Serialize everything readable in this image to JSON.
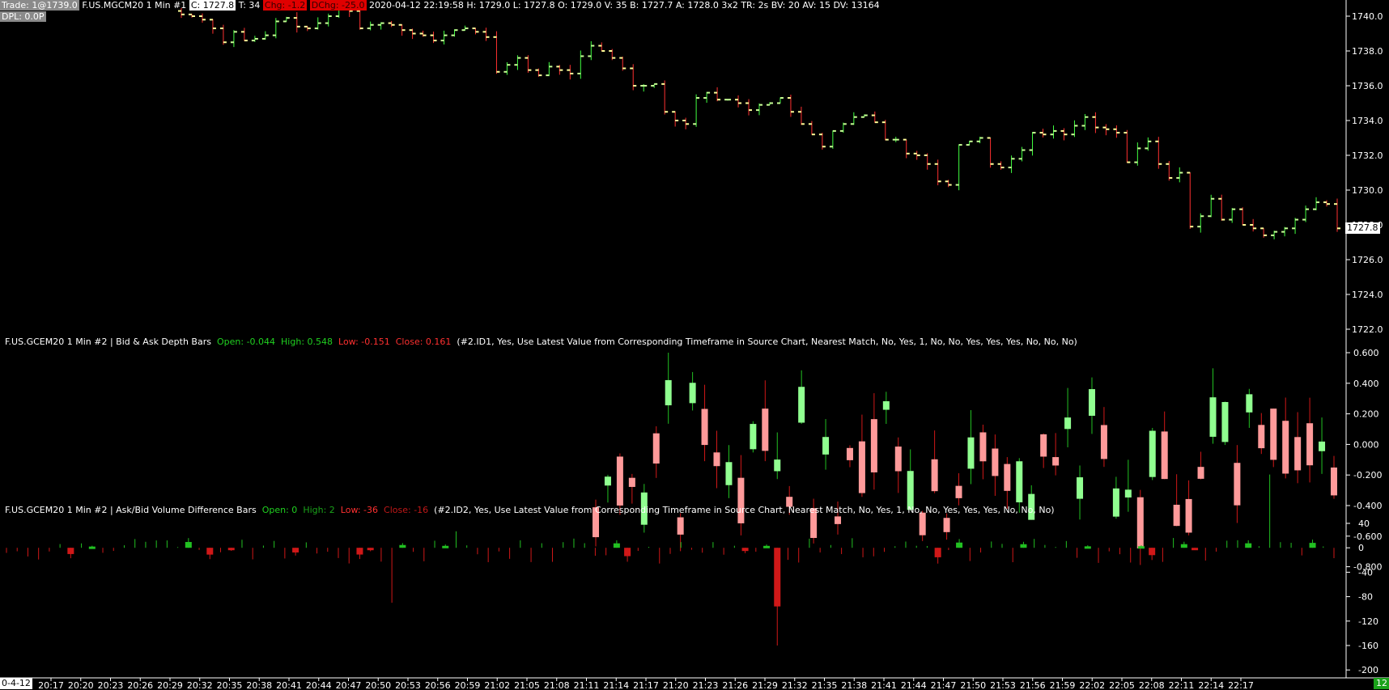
{
  "main_header": {
    "trade": "Trade: 1@1739.0",
    "symbol": "F.US.MGCM20  1 Min",
    "num": "#1",
    "close": "C: 1727.8",
    "ticks": "T: 34",
    "chg": "Chg: -1.2",
    "dchg": "DChg: -25.0",
    "info": "2020-04-12 22:19:58 H: 1729.0 L: 1727.8 O: 1729.0 V: 35 B: 1727.7 A: 1728.0 3x2 TR: 2s BV: 20 AV: 15 DV: 13164",
    "dpl": "DPL: 0.0P"
  },
  "depth_header": {
    "title": "F.US.GCEM20  1 Min   #2 | Bid & Ask Depth Bars",
    "open": "Open: -0.044",
    "high": "High: 0.548",
    "low": "Low: -0.151",
    "close": "Close: 0.161",
    "params": "(#2.ID1, Yes, Use Latest Value from Corresponding Timeframe in Source Chart, Nearest Match, No, Yes, 1, No, No, Yes, Yes, Yes, No, No, No)"
  },
  "vol_header": {
    "title": "F.US.GCEM20  1 Min   #2 | Ask/Bid Volume Difference Bars",
    "open": "Open: 0",
    "high": "High: 2",
    "low": "Low: -36",
    "close": "Close: -16",
    "params": "(#2.ID2, Yes, Use Latest Value from Corresponding Timeframe in Source Chart, Nearest Match, No, Yes, 1, No, No, Yes, Yes, Yes, No, No, No)"
  },
  "price_axis": [
    "1740.0",
    "1738.0",
    "1736.0",
    "1734.0",
    "1732.0",
    "1730.0",
    "1728.0",
    "1726.0",
    "1724.0",
    "1722.0"
  ],
  "current_price": "1727.8",
  "depth_axis": [
    "0.600",
    "0.400",
    "0.200",
    "0.000",
    "-0.200",
    "-0.400",
    "-0.600",
    "-0.800"
  ],
  "vol_axis": [
    "40",
    "0",
    "-40",
    "-80",
    "-120",
    "-160",
    "-200"
  ],
  "time_axis": {
    "date": "0-4-12",
    "times": [
      "20:17",
      "20:20",
      "20:23",
      "20:26",
      "20:29",
      "20:32",
      "20:35",
      "20:38",
      "20:41",
      "20:44",
      "20:47",
      "20:50",
      "20:53",
      "20:56",
      "20:59",
      "21:02",
      "21:05",
      "21:08",
      "21:11",
      "21:14",
      "21:17",
      "21:20",
      "21:23",
      "21:26",
      "21:29",
      "21:32",
      "21:35",
      "21:38",
      "21:41",
      "21:44",
      "21:47",
      "21:50",
      "21:53",
      "21:56",
      "21:59",
      "22:02",
      "22:05",
      "22:08",
      "22:11",
      "22:14",
      "22:17"
    ],
    "bar_count": "12"
  },
  "colors": {
    "up_bar": "#c8ff96",
    "down_bar": "#ffff99",
    "depth_up": "#90ff90",
    "depth_down": "#ff9a9a",
    "vol_up": "#22c022",
    "vol_down": "#d01818",
    "text_green": "#20d020",
    "text_red": "#ff3030"
  },
  "chart_data": [
    {
      "type": "ohlc",
      "title": "F.US.MGCM20 1 Min",
      "ylim": [
        1722,
        1740
      ],
      "close_series": [
        1740.1,
        1740.0,
        1739.8,
        1739.3,
        1738.5,
        1739.1,
        1738.6,
        1738.7,
        1738.9,
        1739.7,
        1739.9,
        1739.4,
        1739.3,
        1739.6,
        1740.0,
        1740.4,
        1740.3,
        1739.3,
        1739.5,
        1739.6,
        1739.5,
        1739.2,
        1739.0,
        1738.9,
        1738.6,
        1738.9,
        1739.2,
        1739.3,
        1739.1,
        1738.8,
        1736.8,
        1737.2,
        1737.6,
        1736.9,
        1736.6,
        1737.1,
        1736.9,
        1736.7,
        1737.7,
        1738.3,
        1738.0,
        1737.6,
        1737.0,
        1736.0,
        1736.0,
        1736.1,
        1734.5,
        1734.0,
        1733.8,
        1735.3,
        1735.6,
        1735.2,
        1735.2,
        1735.0,
        1734.6,
        1734.9,
        1735.0,
        1735.3,
        1734.5,
        1733.8,
        1733.2,
        1732.5,
        1733.4,
        1733.8,
        1734.2,
        1734.3,
        1733.9,
        1732.9,
        1732.9,
        1732.1,
        1732.0,
        1731.5,
        1730.5,
        1730.3,
        1732.6,
        1732.8,
        1733.0,
        1731.5,
        1731.3,
        1731.8,
        1732.3,
        1733.3,
        1733.2,
        1733.4,
        1733.2,
        1733.7,
        1734.2,
        1733.6,
        1733.5,
        1733.3,
        1731.6,
        1732.4,
        1732.8,
        1731.5,
        1730.7,
        1731.0,
        1727.9,
        1728.5,
        1729.5,
        1728.3,
        1728.9,
        1728.0,
        1727.8,
        1727.4,
        1727.6,
        1727.8,
        1728.3,
        1728.9,
        1729.3,
        1729.2,
        1727.8
      ],
      "notes": "Main price OHLC bars, price range approx 1726 to 1740.5"
    },
    {
      "type": "bar",
      "title": "Bid & Ask Depth Bars",
      "ylim": [
        -0.8,
        0.6
      ],
      "open": -0.044,
      "high": 0.548,
      "low": -0.151,
      "close": 0.161
    },
    {
      "type": "bar",
      "title": "Ask/Bid Volume Difference Bars",
      "ylim": [
        -200,
        40
      ],
      "open": 0,
      "high": 2,
      "low": -36,
      "close": -16
    }
  ]
}
